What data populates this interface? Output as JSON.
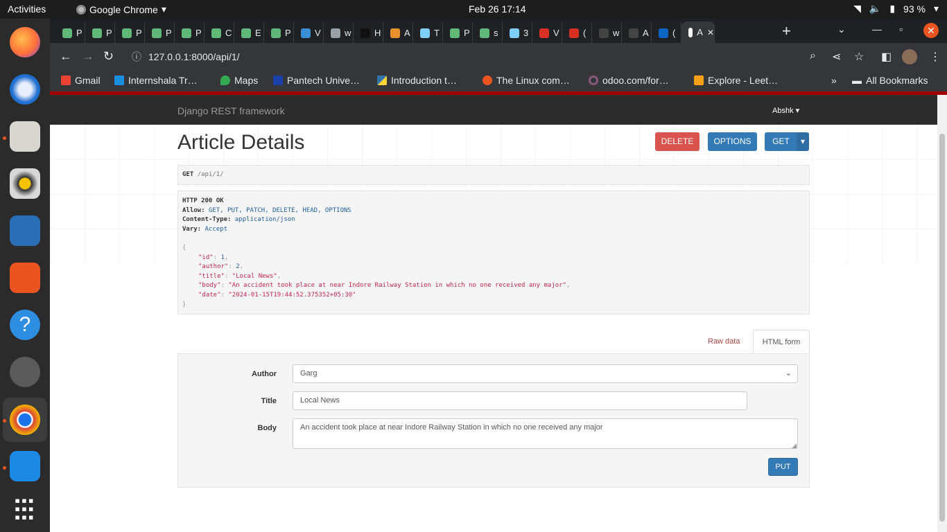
{
  "os": {
    "activities": "Activities",
    "app_name": "Google Chrome",
    "clock": "Feb 26  17:14",
    "battery": "93 %"
  },
  "chrome": {
    "tabs": [
      "P",
      "P",
      "P",
      "P",
      "P",
      "C",
      "E",
      "P",
      "V",
      "w",
      "H",
      "A",
      "T",
      "P",
      "s",
      "3",
      "V",
      "(",
      "w",
      "A",
      "(",
      "A"
    ],
    "url": "127.0.0.1:8000/api/1/",
    "bookmarks": [
      "Gmail",
      "Internshala Tr…",
      "Maps",
      "Pantech Unive…",
      "Introduction t…",
      "The Linux com…",
      "odoo.com/for…",
      "Explore - Leet…"
    ],
    "bookmarks_more": "»",
    "all_bookmarks": "All Bookmarks"
  },
  "page": {
    "brand": "Django REST framework",
    "user": "Abshk",
    "title": "Article Details",
    "buttons": {
      "delete": "DELETE",
      "options": "OPTIONS",
      "get": "GET"
    },
    "request": {
      "method": "GET",
      "path": "/api/1/"
    },
    "response": {
      "status": "HTTP 200 OK",
      "allow_key": "Allow:",
      "allow_val": "GET, PUT, PATCH, DELETE, HEAD, OPTIONS",
      "ctype_key": "Content-Type:",
      "ctype_val": "application/json",
      "vary_key": "Vary:",
      "vary_val": "Accept",
      "body": [
        {
          "key": "\"id\"",
          "val": "1",
          "kind": "lit"
        },
        {
          "key": "\"author\"",
          "val": "2",
          "kind": "lit"
        },
        {
          "key": "\"title\"",
          "val": "\"Local News\"",
          "kind": "str"
        },
        {
          "key": "\"body\"",
          "val": "\"An accident took place at near Indore Railway Station in which no one received any major\"",
          "kind": "str"
        },
        {
          "key": "\"date\"",
          "val": "\"2024-01-15T19:44:52.375352+05:30\"",
          "kind": "str"
        }
      ]
    },
    "form_tabs": {
      "raw": "Raw data",
      "html": "HTML form"
    },
    "form": {
      "author_label": "Author",
      "author_value": "Garg",
      "title_label": "Title",
      "title_value": "Local News",
      "body_label": "Body",
      "body_value": "An accident took place at near Indore Railway Station in which no one received any major",
      "submit": "PUT"
    }
  }
}
